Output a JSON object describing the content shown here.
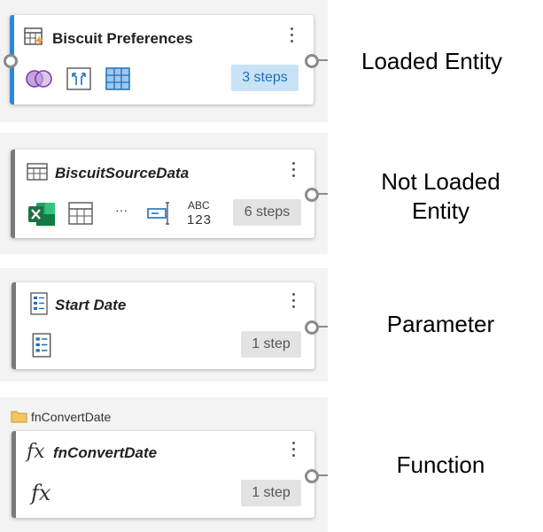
{
  "loaded": {
    "title": "Biscuit Preferences",
    "steps": "3 steps",
    "label": "Loaded Entity"
  },
  "not_loaded": {
    "title": "BiscuitSourceData",
    "steps": "6 steps",
    "ellipsis": "···",
    "abc": "ABC",
    "num": "123",
    "label_line1": "Not Loaded",
    "label_line2": "Entity"
  },
  "parameter": {
    "title": "Start Date",
    "steps": "1 step",
    "label": "Parameter"
  },
  "function": {
    "folder": "fnConvertDate",
    "title": "fnConvertDate",
    "fx": "fx",
    "steps": "1 step",
    "label": "Function"
  },
  "colors": {
    "loaded_stripe": "#2b88d8",
    "entity_stripe": "#7a7a7a",
    "excel_green": "#1e7145",
    "steps_loaded_bg": "#c9e3f6"
  }
}
